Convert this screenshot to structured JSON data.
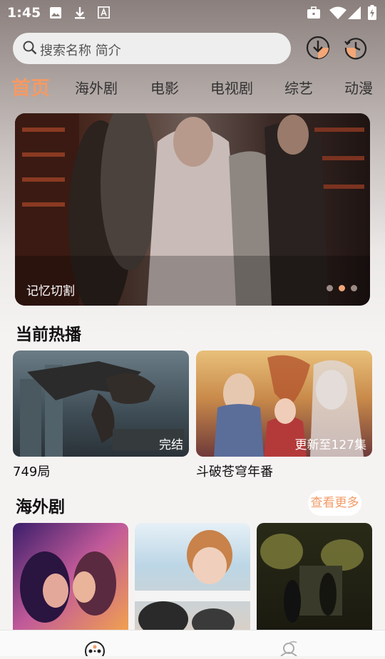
{
  "status_bar": {
    "time": "1:45",
    "icons": [
      "image-icon",
      "download-icon",
      "text-icon",
      "briefcase-icon",
      "wifi-icon",
      "signal-icon",
      "battery-icon"
    ]
  },
  "search": {
    "placeholder": "搜索名称 简介"
  },
  "header_icons": [
    "download-icon",
    "history-icon"
  ],
  "tabs": [
    {
      "label": "首页",
      "active": true
    },
    {
      "label": "海外剧",
      "active": false
    },
    {
      "label": "电影",
      "active": false
    },
    {
      "label": "电视剧",
      "active": false
    },
    {
      "label": "综艺",
      "active": false
    },
    {
      "label": "动漫",
      "active": false
    }
  ],
  "banner": {
    "caption": "记忆切割",
    "slides_count": 3,
    "active_slide": 2
  },
  "now_playing": {
    "title": "当前热播",
    "items": [
      {
        "title": "749局",
        "badge": "完结"
      },
      {
        "title": "斗破苍穹年番",
        "badge": "更新至127集"
      }
    ]
  },
  "overseas": {
    "title": "海外剧",
    "more_label": "查看更多",
    "items": [
      {},
      {},
      {}
    ]
  },
  "bottom_nav": [
    "home-icon",
    "user-icon"
  ],
  "colors": {
    "accent": "#f39a66"
  }
}
